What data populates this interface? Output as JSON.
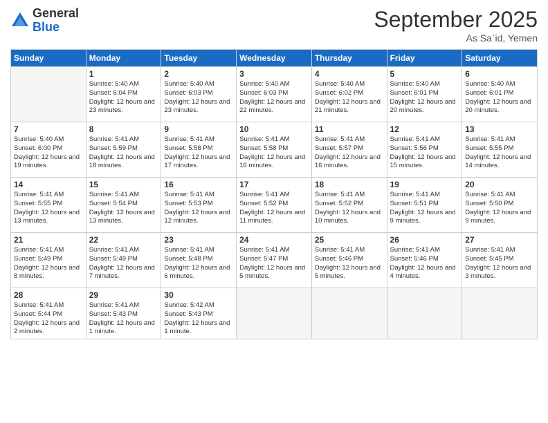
{
  "logo": {
    "general": "General",
    "blue": "Blue"
  },
  "title": "September 2025",
  "subtitle": "As Sa`id, Yemen",
  "days": [
    "Sunday",
    "Monday",
    "Tuesday",
    "Wednesday",
    "Thursday",
    "Friday",
    "Saturday"
  ],
  "weeks": [
    [
      {
        "day": "",
        "info": ""
      },
      {
        "day": "1",
        "info": "Sunrise: 5:40 AM\nSunset: 6:04 PM\nDaylight: 12 hours\nand 23 minutes."
      },
      {
        "day": "2",
        "info": "Sunrise: 5:40 AM\nSunset: 6:03 PM\nDaylight: 12 hours\nand 23 minutes."
      },
      {
        "day": "3",
        "info": "Sunrise: 5:40 AM\nSunset: 6:03 PM\nDaylight: 12 hours\nand 22 minutes."
      },
      {
        "day": "4",
        "info": "Sunrise: 5:40 AM\nSunset: 6:02 PM\nDaylight: 12 hours\nand 21 minutes."
      },
      {
        "day": "5",
        "info": "Sunrise: 5:40 AM\nSunset: 6:01 PM\nDaylight: 12 hours\nand 20 minutes."
      },
      {
        "day": "6",
        "info": "Sunrise: 5:40 AM\nSunset: 6:01 PM\nDaylight: 12 hours\nand 20 minutes."
      }
    ],
    [
      {
        "day": "7",
        "info": "Sunrise: 5:40 AM\nSunset: 6:00 PM\nDaylight: 12 hours\nand 19 minutes."
      },
      {
        "day": "8",
        "info": "Sunrise: 5:41 AM\nSunset: 5:59 PM\nDaylight: 12 hours\nand 18 minutes."
      },
      {
        "day": "9",
        "info": "Sunrise: 5:41 AM\nSunset: 5:58 PM\nDaylight: 12 hours\nand 17 minutes."
      },
      {
        "day": "10",
        "info": "Sunrise: 5:41 AM\nSunset: 5:58 PM\nDaylight: 12 hours\nand 16 minutes."
      },
      {
        "day": "11",
        "info": "Sunrise: 5:41 AM\nSunset: 5:57 PM\nDaylight: 12 hours\nand 16 minutes."
      },
      {
        "day": "12",
        "info": "Sunrise: 5:41 AM\nSunset: 5:56 PM\nDaylight: 12 hours\nand 15 minutes."
      },
      {
        "day": "13",
        "info": "Sunrise: 5:41 AM\nSunset: 5:55 PM\nDaylight: 12 hours\nand 14 minutes."
      }
    ],
    [
      {
        "day": "14",
        "info": "Sunrise: 5:41 AM\nSunset: 5:55 PM\nDaylight: 12 hours\nand 13 minutes."
      },
      {
        "day": "15",
        "info": "Sunrise: 5:41 AM\nSunset: 5:54 PM\nDaylight: 12 hours\nand 13 minutes."
      },
      {
        "day": "16",
        "info": "Sunrise: 5:41 AM\nSunset: 5:53 PM\nDaylight: 12 hours\nand 12 minutes."
      },
      {
        "day": "17",
        "info": "Sunrise: 5:41 AM\nSunset: 5:52 PM\nDaylight: 12 hours\nand 11 minutes."
      },
      {
        "day": "18",
        "info": "Sunrise: 5:41 AM\nSunset: 5:52 PM\nDaylight: 12 hours\nand 10 minutes."
      },
      {
        "day": "19",
        "info": "Sunrise: 5:41 AM\nSunset: 5:51 PM\nDaylight: 12 hours\nand 9 minutes."
      },
      {
        "day": "20",
        "info": "Sunrise: 5:41 AM\nSunset: 5:50 PM\nDaylight: 12 hours\nand 9 minutes."
      }
    ],
    [
      {
        "day": "21",
        "info": "Sunrise: 5:41 AM\nSunset: 5:49 PM\nDaylight: 12 hours\nand 8 minutes."
      },
      {
        "day": "22",
        "info": "Sunrise: 5:41 AM\nSunset: 5:49 PM\nDaylight: 12 hours\nand 7 minutes."
      },
      {
        "day": "23",
        "info": "Sunrise: 5:41 AM\nSunset: 5:48 PM\nDaylight: 12 hours\nand 6 minutes."
      },
      {
        "day": "24",
        "info": "Sunrise: 5:41 AM\nSunset: 5:47 PM\nDaylight: 12 hours\nand 5 minutes."
      },
      {
        "day": "25",
        "info": "Sunrise: 5:41 AM\nSunset: 5:46 PM\nDaylight: 12 hours\nand 5 minutes."
      },
      {
        "day": "26",
        "info": "Sunrise: 5:41 AM\nSunset: 5:46 PM\nDaylight: 12 hours\nand 4 minutes."
      },
      {
        "day": "27",
        "info": "Sunrise: 5:41 AM\nSunset: 5:45 PM\nDaylight: 12 hours\nand 3 minutes."
      }
    ],
    [
      {
        "day": "28",
        "info": "Sunrise: 5:41 AM\nSunset: 5:44 PM\nDaylight: 12 hours\nand 2 minutes."
      },
      {
        "day": "29",
        "info": "Sunrise: 5:41 AM\nSunset: 5:43 PM\nDaylight: 12 hours\nand 1 minute."
      },
      {
        "day": "30",
        "info": "Sunrise: 5:42 AM\nSunset: 5:43 PM\nDaylight: 12 hours\nand 1 minute."
      },
      {
        "day": "",
        "info": ""
      },
      {
        "day": "",
        "info": ""
      },
      {
        "day": "",
        "info": ""
      },
      {
        "day": "",
        "info": ""
      }
    ]
  ]
}
